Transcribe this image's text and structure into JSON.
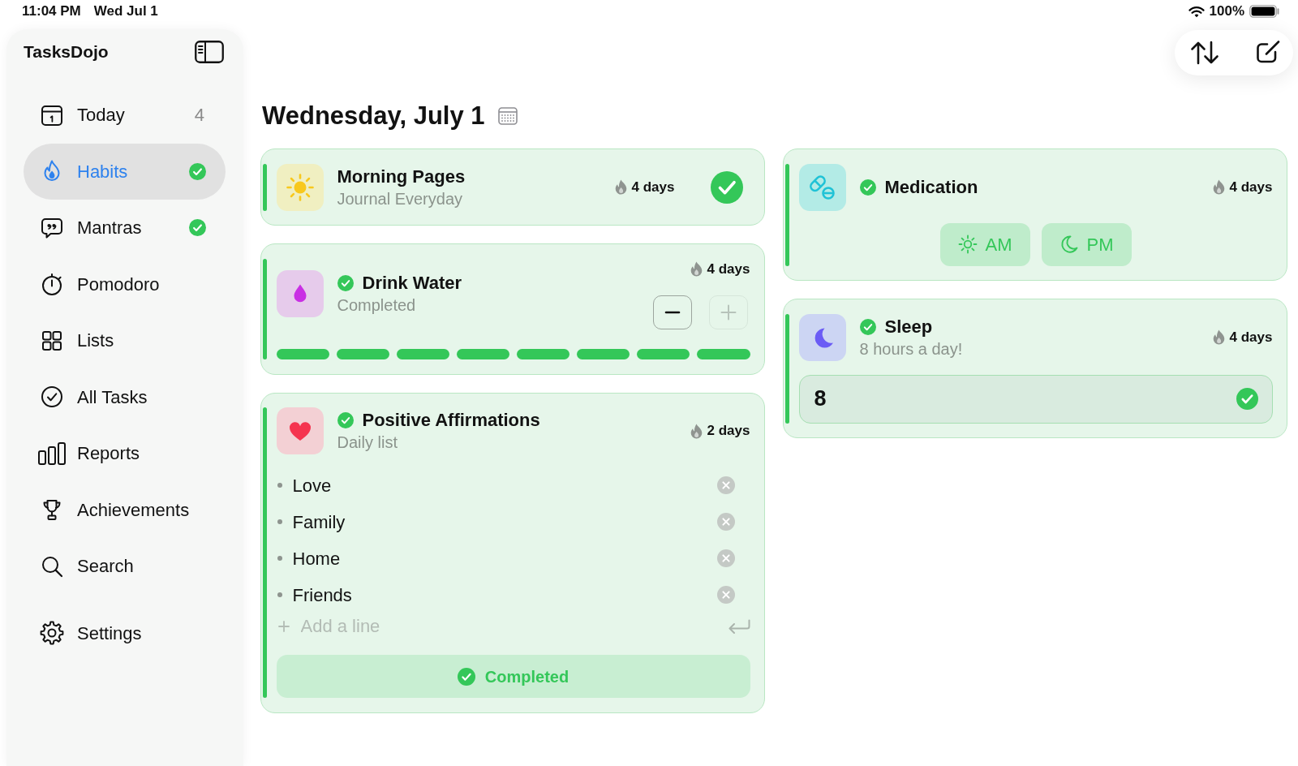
{
  "status_bar": {
    "time": "11:04 PM",
    "date": "Wed Jul 1",
    "battery": "100%"
  },
  "sidebar": {
    "title": "TasksDojo",
    "items": [
      {
        "label": "Today",
        "count": "4",
        "done": false,
        "selected": false
      },
      {
        "label": "Habits",
        "done": true,
        "selected": true
      },
      {
        "label": "Mantras",
        "done": true,
        "selected": false
      },
      {
        "label": "Pomodoro",
        "done": false,
        "selected": false
      },
      {
        "label": "Lists",
        "done": false,
        "selected": false
      },
      {
        "label": "All Tasks",
        "done": false,
        "selected": false
      },
      {
        "label": "Reports",
        "done": false,
        "selected": false
      },
      {
        "label": "Achievements",
        "done": false,
        "selected": false
      },
      {
        "label": "Search",
        "done": false,
        "selected": false
      }
    ],
    "footer_items": [
      {
        "label": "Settings",
        "done": false,
        "selected": false
      }
    ]
  },
  "heading": "Wednesday, July 1",
  "habit_columns": [
    {
      "habits": [
        {
          "kind": "check",
          "title": "Morning Pages",
          "subtitle": "Journal Everyday",
          "streak": "4 days",
          "completed": true
        },
        {
          "kind": "counter",
          "title": "Drink Water",
          "subtitle": "Completed",
          "streak": "4 days",
          "completed": true,
          "decrement": {
            "disabled": false
          },
          "increment": {
            "disabled": true
          },
          "segments": [
            {
              "filled": true
            },
            {
              "filled": true
            },
            {
              "filled": true
            },
            {
              "filled": true
            },
            {
              "filled": true
            },
            {
              "filled": true
            },
            {
              "filled": true
            },
            {
              "filled": true
            }
          ]
        },
        {
          "kind": "list",
          "title": "Positive Affirmations",
          "subtitle": "Daily list",
          "streak": "2 days",
          "completed": true,
          "lines": [
            "Love",
            "Family",
            "Home",
            "Friends"
          ],
          "new_line": {
            "placeholder": "Add a line"
          },
          "action": {
            "label": "Completed"
          }
        }
      ]
    },
    {
      "habits": [
        {
          "kind": "doses",
          "title": "Medication",
          "streak": "4 days",
          "completed": true,
          "doses": [
            {
              "label": "AM"
            },
            {
              "label": "PM"
            }
          ]
        },
        {
          "kind": "number",
          "title": "Sleep",
          "subtitle": "8 hours a day!",
          "streak": "4 days",
          "completed": true,
          "entry": {
            "value": "8"
          }
        }
      ]
    }
  ]
}
